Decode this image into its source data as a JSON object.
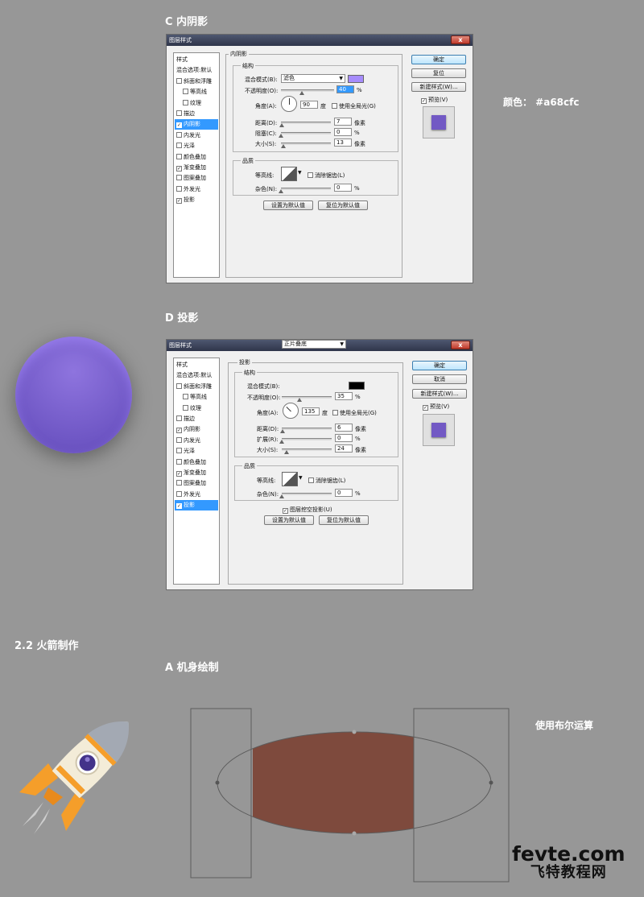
{
  "sections": {
    "c_title": "C  内阴影",
    "d_title": "D  投影",
    "s22_title": "2.2  火箭制作",
    "a_title": "A  机身绘制"
  },
  "notes": {
    "color_note": "颜色：  #a68cfc",
    "boolean_note": "使用布尔运算"
  },
  "colors": {
    "inner_shadow": "#a68cfc",
    "drop_shadow": "#000000",
    "circle_fill": "#6e56c4",
    "rocket_body": "#7e4a3d",
    "background": "#979797",
    "selection": "#3399ff"
  },
  "dialog_c": {
    "title": "图层样式",
    "close": "x",
    "sidebar": [
      {
        "label": "样式",
        "checkbox": false,
        "checked": false,
        "selected": false,
        "indent": 0
      },
      {
        "label": "混合选项:默认",
        "checkbox": false,
        "checked": false,
        "selected": false,
        "indent": 0
      },
      {
        "label": "斜面和浮雕",
        "checkbox": true,
        "checked": false,
        "selected": false,
        "indent": 0
      },
      {
        "label": "等高线",
        "checkbox": true,
        "checked": false,
        "selected": false,
        "indent": 1
      },
      {
        "label": "纹理",
        "checkbox": true,
        "checked": false,
        "selected": false,
        "indent": 1
      },
      {
        "label": "描边",
        "checkbox": true,
        "checked": false,
        "selected": false,
        "indent": 0
      },
      {
        "label": "内阴影",
        "checkbox": true,
        "checked": true,
        "selected": true,
        "indent": 0
      },
      {
        "label": "内发光",
        "checkbox": true,
        "checked": false,
        "selected": false,
        "indent": 0
      },
      {
        "label": "光泽",
        "checkbox": true,
        "checked": false,
        "selected": false,
        "indent": 0
      },
      {
        "label": "颜色叠加",
        "checkbox": true,
        "checked": false,
        "selected": false,
        "indent": 0
      },
      {
        "label": "渐变叠加",
        "checkbox": true,
        "checked": true,
        "selected": false,
        "indent": 0
      },
      {
        "label": "图案叠加",
        "checkbox": true,
        "checked": false,
        "selected": false,
        "indent": 0
      },
      {
        "label": "外发光",
        "checkbox": true,
        "checked": false,
        "selected": false,
        "indent": 0
      },
      {
        "label": "投影",
        "checkbox": true,
        "checked": true,
        "selected": false,
        "indent": 0
      }
    ],
    "panel_title": "内阴影",
    "structure_label": "结构",
    "blend_mode_label": "混合模式(B):",
    "blend_mode_value": "滤色",
    "opacity_label": "不透明度(O):",
    "opacity_value": "40",
    "opacity_pct": 40,
    "angle_label": "角度(A):",
    "angle_value": "90",
    "angle_deg": 90,
    "degree_unit": "度",
    "global_light_label": "使用全局光(G)",
    "distance_label": "距离(D):",
    "distance_value": "7",
    "distance_frac": 0.02,
    "choke_label": "阻塞(C):",
    "choke_value": "0",
    "choke_frac": 0,
    "size_label": "大小(S):",
    "size_value": "13",
    "size_frac": 0.05,
    "px_unit": "像素",
    "pct_unit": "%",
    "quality_label": "品质",
    "contour_label": "等高线:",
    "antialias_label": "消除锯齿(L)",
    "noise_label": "杂色(N):",
    "noise_value": "0",
    "make_default": "设置为默认值",
    "reset_default": "复位为默认值",
    "ok": "确定",
    "reset": "复位",
    "new_style": "新建样式(W)...",
    "preview": "预览(V)"
  },
  "dialog_d": {
    "title": "图层样式",
    "close": "x",
    "sidebar": [
      {
        "label": "样式",
        "checkbox": false,
        "checked": false,
        "selected": false,
        "indent": 0
      },
      {
        "label": "混合选项:默认",
        "checkbox": false,
        "checked": false,
        "selected": false,
        "indent": 0
      },
      {
        "label": "斜面和浮雕",
        "checkbox": true,
        "checked": false,
        "selected": false,
        "indent": 0
      },
      {
        "label": "等高线",
        "checkbox": true,
        "checked": false,
        "selected": false,
        "indent": 1
      },
      {
        "label": "纹理",
        "checkbox": true,
        "checked": false,
        "selected": false,
        "indent": 1
      },
      {
        "label": "描边",
        "checkbox": true,
        "checked": false,
        "selected": false,
        "indent": 0
      },
      {
        "label": "内阴影",
        "checkbox": true,
        "checked": true,
        "selected": false,
        "indent": 0
      },
      {
        "label": "内发光",
        "checkbox": true,
        "checked": false,
        "selected": false,
        "indent": 0
      },
      {
        "label": "光泽",
        "checkbox": true,
        "checked": false,
        "selected": false,
        "indent": 0
      },
      {
        "label": "颜色叠加",
        "checkbox": true,
        "checked": false,
        "selected": false,
        "indent": 0
      },
      {
        "label": "渐变叠加",
        "checkbox": true,
        "checked": true,
        "selected": false,
        "indent": 0
      },
      {
        "label": "图案叠加",
        "checkbox": true,
        "checked": false,
        "selected": false,
        "indent": 0
      },
      {
        "label": "外发光",
        "checkbox": true,
        "checked": false,
        "selected": false,
        "indent": 0
      },
      {
        "label": "投影",
        "checkbox": true,
        "checked": true,
        "selected": true,
        "indent": 0
      }
    ],
    "panel_title": "投影",
    "structure_label": "结构",
    "blend_mode_label": "混合模式(B):",
    "blend_mode_value": "正片叠底",
    "opacity_label": "不透明度(O):",
    "opacity_value": "35",
    "opacity_pct": 35,
    "angle_label": "角度(A):",
    "angle_value": "135",
    "angle_deg": 135,
    "degree_unit": "度",
    "global_light_label": "使用全局光(G)",
    "distance_label": "距离(D):",
    "distance_value": "6",
    "distance_frac": 0.02,
    "spread_label": "扩展(R):",
    "spread_value": "0",
    "spread_frac": 0,
    "size_label": "大小(S):",
    "size_value": "24",
    "size_frac": 0.09,
    "px_unit": "像素",
    "pct_unit": "%",
    "quality_label": "品质",
    "contour_label": "等高线:",
    "antialias_label": "消除锯齿(L)",
    "noise_label": "杂色(N):",
    "noise_value": "0",
    "knockout_label": "图层挖空投影(U)",
    "make_default": "设置为默认值",
    "reset_default": "复位为默认值",
    "ok": "确定",
    "cancel": "取消",
    "new_style": "新建样式(W)...",
    "preview": "预览(V)"
  },
  "logo": {
    "line1": "fevte.com",
    "line2": "飞特教程网"
  }
}
